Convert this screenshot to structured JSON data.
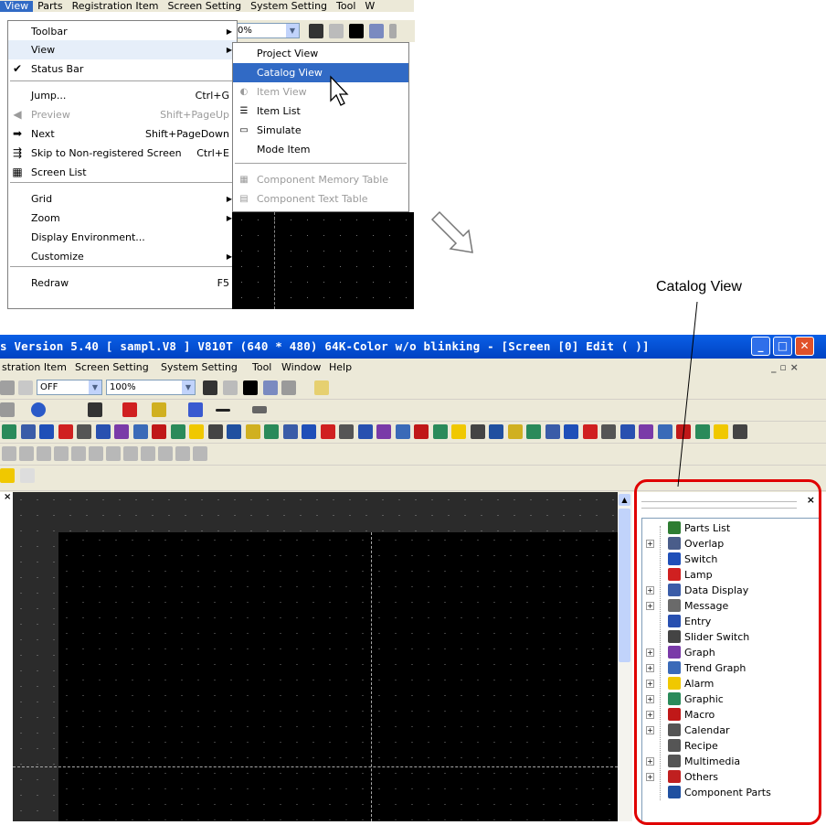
{
  "top_menu": {
    "items": [
      "View",
      "Parts",
      "Registration Item",
      "Screen Setting",
      "System Setting",
      "Tool",
      "W"
    ]
  },
  "view_menu": {
    "items": [
      {
        "label": "Toolbar",
        "shortcut": "",
        "submenu": true,
        "disabled": false
      },
      {
        "label": "View",
        "shortcut": "",
        "submenu": true,
        "disabled": false
      },
      {
        "label": "Status Bar",
        "shortcut": "",
        "submenu": false,
        "disabled": false,
        "checked": true
      },
      {
        "label": "Jump...",
        "shortcut": "Ctrl+G",
        "submenu": false,
        "disabled": false
      },
      {
        "label": "Preview",
        "shortcut": "Shift+PageUp",
        "submenu": false,
        "disabled": true
      },
      {
        "label": "Next",
        "shortcut": "Shift+PageDown",
        "submenu": false,
        "disabled": false
      },
      {
        "label": "Skip to Non-registered Screen",
        "shortcut": "Ctrl+E",
        "submenu": false,
        "disabled": false
      },
      {
        "label": "Screen List",
        "shortcut": "",
        "submenu": false,
        "disabled": false
      },
      {
        "label": "Grid",
        "shortcut": "",
        "submenu": true,
        "disabled": false
      },
      {
        "label": "Zoom",
        "shortcut": "",
        "submenu": true,
        "disabled": false
      },
      {
        "label": "Display Environment...",
        "shortcut": "",
        "submenu": false,
        "disabled": false
      },
      {
        "label": "Customize",
        "shortcut": "",
        "submenu": true,
        "disabled": false
      },
      {
        "label": "Redraw",
        "shortcut": "F5",
        "submenu": false,
        "disabled": false
      }
    ]
  },
  "sub_menu": {
    "items": [
      {
        "label": "Project View",
        "disabled": false
      },
      {
        "label": "Catalog View",
        "disabled": false,
        "selected": true
      },
      {
        "label": "Item View",
        "disabled": true
      },
      {
        "label": "Item List",
        "disabled": false
      },
      {
        "label": "Simulate",
        "disabled": false
      },
      {
        "label": "Mode Item",
        "disabled": false
      },
      {
        "label": "Component Memory Table",
        "disabled": true
      },
      {
        "label": "Component Text Table",
        "disabled": true
      }
    ],
    "zoom_fragment": "0%"
  },
  "callout": {
    "label": "Catalog View"
  },
  "window": {
    "title": "s Version 5.40 [ sampl.V8 ] V810T (640 * 480) 64K-Color w/o blinking - [Screen [0] Edit (          )]",
    "menu": [
      "stration Item",
      "Screen Setting",
      "System Setting",
      "Tool",
      "Window",
      "Help"
    ],
    "toolbar": {
      "off_label": "OFF",
      "zoom_value": "100%"
    },
    "buttons": {
      "minimize": "_",
      "maximize": "□",
      "close": "✕"
    }
  },
  "catalog_view": {
    "close_label": "×",
    "items": [
      {
        "label": "Parts List",
        "expandable": false,
        "icon_color": "#2e7d32"
      },
      {
        "label": "Overlap",
        "expandable": true,
        "icon_color": "#4a5d8a"
      },
      {
        "label": "Switch",
        "expandable": false,
        "icon_color": "#1f4fb8"
      },
      {
        "label": "Lamp",
        "expandable": false,
        "icon_color": "#d02020"
      },
      {
        "label": "Data Display",
        "expandable": true,
        "icon_color": "#3a5ca8"
      },
      {
        "label": "Message",
        "expandable": true,
        "icon_color": "#6a6a6a"
      },
      {
        "label": "Entry",
        "expandable": false,
        "icon_color": "#2850b0"
      },
      {
        "label": "Slider Switch",
        "expandable": false,
        "icon_color": "#444444"
      },
      {
        "label": "Graph",
        "expandable": true,
        "icon_color": "#7a3aa8"
      },
      {
        "label": "Trend Graph",
        "expandable": true,
        "icon_color": "#3a6ab8"
      },
      {
        "label": "Alarm",
        "expandable": true,
        "icon_color": "#f0c800"
      },
      {
        "label": "Graphic",
        "expandable": true,
        "icon_color": "#2a8a5a"
      },
      {
        "label": "Macro",
        "expandable": true,
        "icon_color": "#c01818"
      },
      {
        "label": "Calendar",
        "expandable": true,
        "icon_color": "#555555"
      },
      {
        "label": "Recipe",
        "expandable": false,
        "icon_color": "#555555"
      },
      {
        "label": "Multimedia",
        "expandable": true,
        "icon_color": "#555555"
      },
      {
        "label": "Others",
        "expandable": true,
        "icon_color": "#c02020"
      },
      {
        "label": "Component Parts",
        "expandable": false,
        "icon_color": "#2050a0"
      }
    ]
  },
  "colors": {
    "selection": "#316ac5",
    "title_bar": "#0a5fe6",
    "highlight_outline": "#e00000"
  }
}
